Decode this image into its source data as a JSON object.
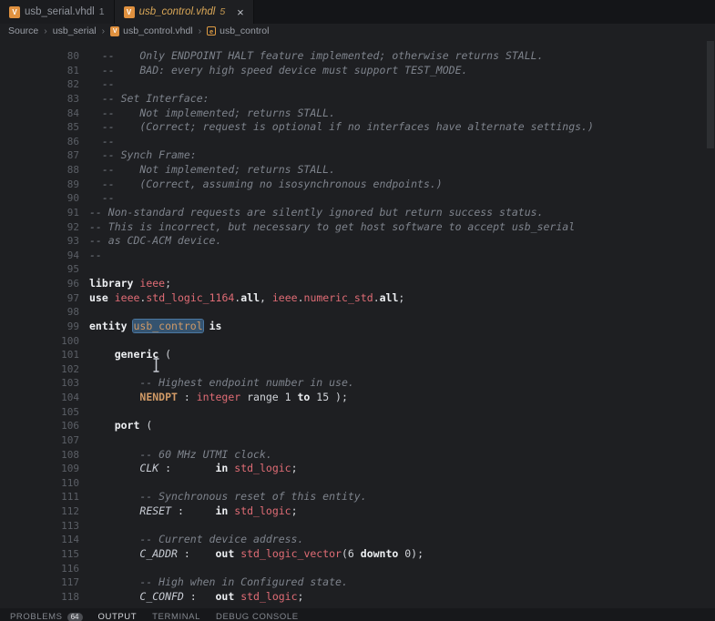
{
  "tabs": [
    {
      "label": "usb_serial.vhdl",
      "badge": "1"
    },
    {
      "label": "usb_control.vhdl",
      "badge": "5",
      "close_label": "×"
    }
  ],
  "breadcrumb": {
    "separator": "›",
    "items": [
      "Source",
      "usb_serial",
      "usb_control.vhdl",
      "usb_control"
    ]
  },
  "icons": {
    "vhdl_file_letter": "V",
    "entity_symbol": "e"
  },
  "panel": {
    "active": "OUTPUT",
    "tabs": [
      {
        "label": "PROBLEMS",
        "badge": "64"
      },
      {
        "label": "OUTPUT"
      },
      {
        "label": "TERMINAL"
      },
      {
        "label": "DEBUG CONSOLE"
      }
    ]
  },
  "colors": {
    "editor_bg": "#1e1f22",
    "tabbar_bg": "#141518",
    "active_tab_label": "#d8a657",
    "keyword": "#edeff2",
    "type_name": "#e06c75",
    "identifier": "#d19a66",
    "comment": "#7e838c",
    "word_highlight_bg": "#35536f"
  },
  "editor": {
    "first_line_number": 80,
    "last_line_number": 118,
    "lines": [
      {
        "n": 80,
        "toks": [
          [
            "c",
            "  --    Only ENDPOINT HALT feature implemented; otherwise returns STALL."
          ]
        ]
      },
      {
        "n": 81,
        "toks": [
          [
            "c",
            "  --    BAD: every high speed device must support TEST_MODE."
          ]
        ]
      },
      {
        "n": 82,
        "toks": [
          [
            "c",
            "  --"
          ]
        ]
      },
      {
        "n": 83,
        "toks": [
          [
            "c",
            "  -- Set Interface:"
          ]
        ]
      },
      {
        "n": 84,
        "toks": [
          [
            "c",
            "  --    Not implemented; returns STALL."
          ]
        ]
      },
      {
        "n": 85,
        "toks": [
          [
            "c",
            "  --    (Correct; request is optional if no interfaces have alternate settings.)"
          ]
        ]
      },
      {
        "n": 86,
        "toks": [
          [
            "c",
            "  --"
          ]
        ]
      },
      {
        "n": 87,
        "toks": [
          [
            "c",
            "  -- Synch Frame:"
          ]
        ]
      },
      {
        "n": 88,
        "toks": [
          [
            "c",
            "  --    Not implemented; returns STALL."
          ]
        ]
      },
      {
        "n": 89,
        "toks": [
          [
            "c",
            "  --    (Correct, assuming no isosynchronous endpoints.)"
          ]
        ]
      },
      {
        "n": 90,
        "toks": [
          [
            "c",
            "  --"
          ]
        ]
      },
      {
        "n": 91,
        "toks": [
          [
            "c",
            "-- Non-standard requests are silently ignored but return success status."
          ]
        ]
      },
      {
        "n": 92,
        "toks": [
          [
            "c",
            "-- This is incorrect, but necessary to get host software to accept usb_serial"
          ]
        ]
      },
      {
        "n": 93,
        "toks": [
          [
            "c",
            "-- as CDC-ACM device."
          ]
        ]
      },
      {
        "n": 94,
        "toks": [
          [
            "c",
            "--"
          ]
        ]
      },
      {
        "n": 95,
        "toks": []
      },
      {
        "n": 96,
        "toks": [
          [
            "k",
            "library"
          ],
          [
            "p",
            " "
          ],
          [
            "t",
            "ieee"
          ],
          [
            "p",
            ";"
          ]
        ]
      },
      {
        "n": 97,
        "toks": [
          [
            "k",
            "use"
          ],
          [
            "p",
            " "
          ],
          [
            "t",
            "ieee"
          ],
          [
            "p",
            "."
          ],
          [
            "t",
            "std_logic_1164"
          ],
          [
            "p",
            "."
          ],
          [
            "k",
            "all"
          ],
          [
            "p",
            ", "
          ],
          [
            "t",
            "ieee"
          ],
          [
            "p",
            "."
          ],
          [
            "t",
            "numeric_std"
          ],
          [
            "p",
            "."
          ],
          [
            "k",
            "all"
          ],
          [
            "p",
            ";"
          ]
        ]
      },
      {
        "n": 98,
        "toks": []
      },
      {
        "n": 99,
        "toks": [
          [
            "k",
            "entity"
          ],
          [
            "p",
            " "
          ],
          [
            "h",
            "usb_control"
          ],
          [
            "p",
            " "
          ],
          [
            "k",
            "is"
          ]
        ]
      },
      {
        "n": 100,
        "toks": []
      },
      {
        "n": 101,
        "toks": [
          [
            "p",
            "    "
          ],
          [
            "k",
            "generic"
          ],
          [
            "p",
            " ("
          ]
        ]
      },
      {
        "n": 102,
        "toks": []
      },
      {
        "n": 103,
        "toks": [
          [
            "c",
            "        -- Highest endpoint number in use."
          ]
        ]
      },
      {
        "n": 104,
        "toks": [
          [
            "p",
            "        "
          ],
          [
            "i",
            "NENDPT"
          ],
          [
            "p",
            " : "
          ],
          [
            "t",
            "integer"
          ],
          [
            "p",
            " range 1 "
          ],
          [
            "k",
            "to"
          ],
          [
            "p",
            " 15 );"
          ]
        ]
      },
      {
        "n": 105,
        "toks": []
      },
      {
        "n": 106,
        "toks": [
          [
            "p",
            "    "
          ],
          [
            "k",
            "port"
          ],
          [
            "p",
            " ("
          ]
        ]
      },
      {
        "n": 107,
        "toks": []
      },
      {
        "n": 108,
        "toks": [
          [
            "c",
            "        -- 60 MHz UTMI clock."
          ]
        ]
      },
      {
        "n": 109,
        "toks": [
          [
            "p",
            "        "
          ],
          [
            "v",
            "CLK"
          ],
          [
            "p",
            " :       "
          ],
          [
            "k",
            "in"
          ],
          [
            "p",
            " "
          ],
          [
            "t",
            "std_logic"
          ],
          [
            "p",
            ";"
          ]
        ]
      },
      {
        "n": 110,
        "toks": []
      },
      {
        "n": 111,
        "toks": [
          [
            "c",
            "        -- Synchronous reset of this entity."
          ]
        ]
      },
      {
        "n": 112,
        "toks": [
          [
            "p",
            "        "
          ],
          [
            "v",
            "RESET"
          ],
          [
            "p",
            " :     "
          ],
          [
            "k",
            "in"
          ],
          [
            "p",
            " "
          ],
          [
            "t",
            "std_logic"
          ],
          [
            "p",
            ";"
          ]
        ]
      },
      {
        "n": 113,
        "toks": []
      },
      {
        "n": 114,
        "toks": [
          [
            "c",
            "        -- Current device address."
          ]
        ]
      },
      {
        "n": 115,
        "toks": [
          [
            "p",
            "        "
          ],
          [
            "v",
            "C_ADDR"
          ],
          [
            "p",
            " :    "
          ],
          [
            "k",
            "out"
          ],
          [
            "p",
            " "
          ],
          [
            "t",
            "std_logic_vector"
          ],
          [
            "p",
            "(6 "
          ],
          [
            "k",
            "downto"
          ],
          [
            "p",
            " 0);"
          ]
        ]
      },
      {
        "n": 116,
        "toks": []
      },
      {
        "n": 117,
        "toks": [
          [
            "c",
            "        -- High when in Configured state."
          ]
        ]
      },
      {
        "n": 118,
        "toks": [
          [
            "p",
            "        "
          ],
          [
            "v",
            "C_CONFD"
          ],
          [
            "p",
            " :   "
          ],
          [
            "k",
            "out"
          ],
          [
            "p",
            " "
          ],
          [
            "t",
            "std_logic"
          ],
          [
            "p",
            ";"
          ]
        ]
      }
    ]
  }
}
